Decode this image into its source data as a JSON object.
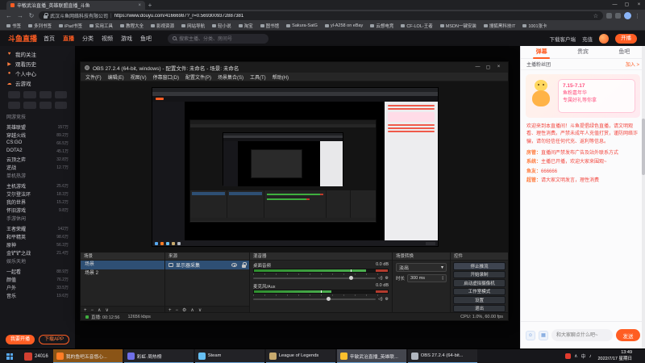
{
  "icons": {
    "back": "←",
    "forward": "→",
    "reload": "↻",
    "star": "☆",
    "menu": "⋮",
    "close": "×",
    "minimize": "—",
    "maximize": "▢",
    "newtab": "+",
    "overflow": "»",
    "plus": "+",
    "minus": "−",
    "up": "∧",
    "down": "∨",
    "gear": "⚙",
    "spin_up": "▴",
    "spin_down": "▾",
    "emoji": "☺",
    "image": "▦",
    "speaker": "◁)",
    "dropdown": "▾"
  },
  "browser": {
    "tab_title": "辛敏武治直播_英雄联盟直播_斗鱼",
    "cert": "武汉斗鱼网络科技有限公司",
    "url": "https://www.douyu.com/41666987?_r=0.5693009372887381",
    "bookmarks": [
      "书签",
      "多列书签",
      "iPad书签",
      "实用工具",
      "教程大全",
      "影视资源",
      "网站导航",
      "轻小说",
      "淘宝",
      "图书馆",
      "Sakura-SatG",
      "yl-A258 on eBay",
      "云想电竞",
      "CF-LOL-王者",
      "MSDN一键安装",
      "搜狐黑科技IT",
      "1001张卡"
    ]
  },
  "site_header": {
    "logo": "斗鱼直播",
    "nav": [
      {
        "label": "首页"
      },
      {
        "label": "直播",
        "cls": "active"
      },
      {
        "label": "分类"
      },
      {
        "label": "视频"
      },
      {
        "label": "游戏"
      },
      {
        "label": "鱼吧"
      }
    ],
    "search_placeholder": "搜索主播、分类、房间号",
    "actions": [
      "下载客户端",
      "充值"
    ],
    "broadcast": "开播"
  },
  "sidebar": {
    "quick": [
      {
        "icon": "♥",
        "label": "我的关注"
      },
      {
        "icon": "▶",
        "label": "观看历史"
      },
      {
        "icon": "●",
        "label": "个人中心"
      },
      {
        "icon": "☁",
        "label": "云游戏"
      }
    ],
    "sections": [
      {
        "title": "网游竞技",
        "items": [
          {
            "name": "英雄联盟",
            "count": "157万"
          },
          {
            "name": "穿越火线",
            "count": "89.2万"
          },
          {
            "name": "CS:GO",
            "count": "66.5万"
          },
          {
            "name": "DOTA2",
            "count": "45.1万"
          },
          {
            "name": "云顶之弈",
            "count": "32.8万"
          },
          {
            "name": "逆战",
            "count": "12.7万"
          }
        ]
      },
      {
        "title": "单机热游",
        "items": [
          {
            "name": "主机游戏",
            "count": "25.6万"
          },
          {
            "name": "艾尔登法环",
            "count": "18.3万"
          },
          {
            "name": "我的世界",
            "count": "15.2万"
          },
          {
            "name": "怀旧游戏",
            "count": "9.8万"
          }
        ]
      },
      {
        "title": "手游休闲",
        "items": [
          {
            "name": "王者荣耀",
            "count": "142万"
          },
          {
            "name": "和平精英",
            "count": "98.6万"
          },
          {
            "name": "原神",
            "count": "56.3万"
          },
          {
            "name": "金铲铲之战",
            "count": "21.4万"
          }
        ]
      },
      {
        "title": "娱乐天地",
        "items": [
          {
            "name": "一起看",
            "count": "88.9万"
          },
          {
            "name": "颜值",
            "count": "76.2万"
          },
          {
            "name": "户外",
            "count": "33.5万"
          },
          {
            "name": "音乐",
            "count": "19.6万"
          }
        ]
      }
    ],
    "bottom_buttons": [
      "我要开播",
      "下载APP"
    ]
  },
  "obs": {
    "title": "OBS 27.2.4 (64-bit, windows) - 配置文件: 未命名 - 场景: 未命名",
    "menu": [
      "文件(F)",
      "编辑(E)",
      "视图(V)",
      "停靠窗口(D)",
      "配置文件(P)",
      "场景集合(S)",
      "工具(T)",
      "帮助(H)"
    ],
    "docks": {
      "scenes": "场景",
      "sources": "来源",
      "mixer": "混音器",
      "transitions": "场景转换",
      "controls": "控件"
    },
    "scenes": [
      "场景",
      "场景 2"
    ],
    "sources": [
      {
        "name": "显示器采集"
      }
    ],
    "mixer": {
      "channels": [
        {
          "name": "桌面音频",
          "db": "0.0 dB"
        },
        {
          "name": "麦克风/Aux",
          "db": "0.0 dB"
        }
      ]
    },
    "transitions": {
      "selected": "淡出",
      "duration_label": "时长",
      "duration": "300 ms"
    },
    "controls": [
      "停止推流",
      "开始录制",
      "启动虚拟摄像机",
      "工作室模式",
      "设置",
      "退出"
    ],
    "status": {
      "left": "直播: 00:12:56",
      "mid": "12656 kbps",
      "right": "CPU: 1.0%, 60.00 fps"
    }
  },
  "chat": {
    "tabs": [
      {
        "label": "弹幕",
        "cls": "active"
      },
      {
        "label": "贵宾"
      },
      {
        "label": "鱼吧"
      }
    ],
    "fan_bar": {
      "label": "主播粉丝团",
      "action": "加入 >"
    },
    "promo": {
      "badge": "7.15-7.17",
      "line1": "鱼粉嘉年华",
      "line2": "专属好礼等你拿"
    },
    "announcement": "欢迎来到本直播间！斗鱼提倡绿色直播，请文明观看、理性消费。严禁未成年人充值打赏，谨防网络诈骗，请勿轻信任何代充、返利等信息。",
    "messages": [
      {
        "user": "房管",
        "text": "直播间严禁发布广告及站外联系方式"
      },
      {
        "user": "系统",
        "text": "主播已开播，欢迎大家来围观~"
      },
      {
        "user": "鱼友",
        "text": "666666"
      },
      {
        "user": "超管",
        "text": "请大家文明发言，理性消费"
      }
    ],
    "input_placeholder": "和大家聊点什么吧~",
    "send": "发送"
  },
  "taskbar": {
    "widget": "24016",
    "apps": [
      {
        "label": "我的鱼吧五音悠心...",
        "color": "#ff7d26",
        "cls": "flash"
      },
      {
        "label": "彩虹·周热榜",
        "color": "#6f6fe8"
      },
      {
        "label": "Steam",
        "color": "#66c0f4"
      },
      {
        "label": "League of Legends",
        "color": "#c8aa6e"
      },
      {
        "label": "辛敏武治直播_英雄联...",
        "color": "#fbc02d",
        "cls": "active"
      },
      {
        "label": "OBS 27.2.4 (64-bit...",
        "color": "#b0b6bf"
      }
    ],
    "tray_icons": [
      "∧",
      "中",
      "♪"
    ],
    "clock": {
      "time": "13:49",
      "date": "2022/7/17 星期日"
    }
  }
}
